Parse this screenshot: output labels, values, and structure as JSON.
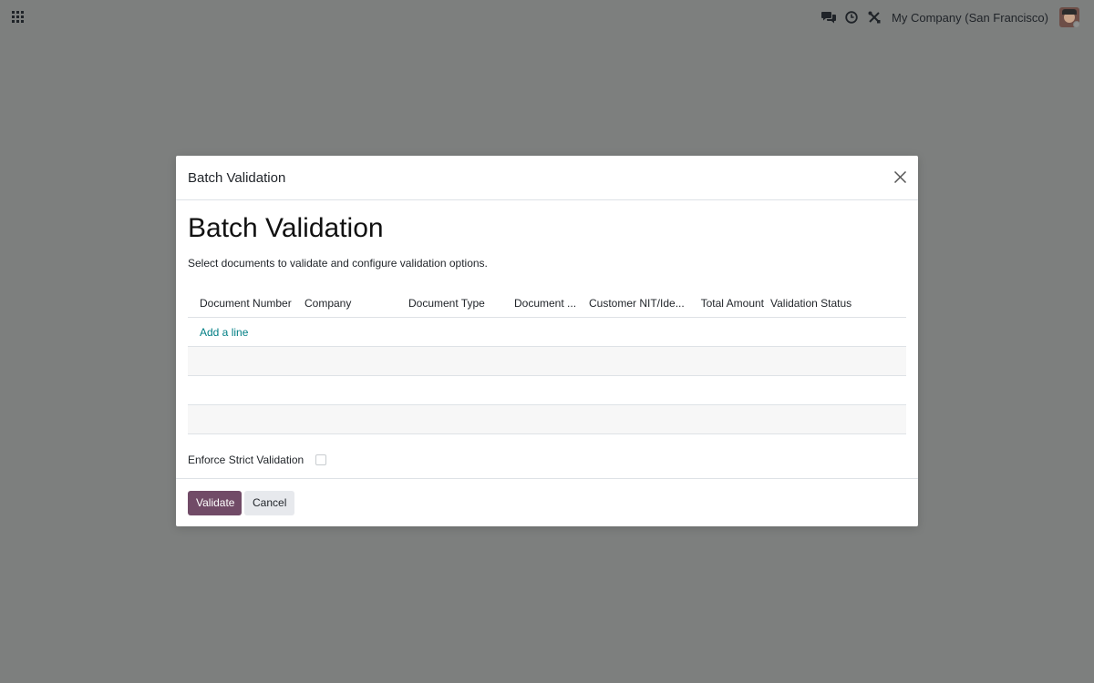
{
  "navbar": {
    "company": "My Company (San Francisco)",
    "icons": [
      "apps-icon",
      "chat-icon",
      "clock-icon",
      "tools-icon"
    ]
  },
  "dialog": {
    "header_title": "Batch Validation",
    "form_title": "Batch Validation",
    "description": "Select documents to validate and configure validation options.",
    "columns": [
      "Document Number",
      "Company",
      "Document Type",
      "Document ...",
      "Customer NIT/Ide...",
      "Total Amount",
      "Validation Status"
    ],
    "add_line": "Add a line",
    "strict_label": "Enforce Strict Validation",
    "strict_checked": false,
    "validate_label": "Validate",
    "cancel_label": "Cancel"
  },
  "colors": {
    "primary": "#714b67",
    "link": "#017e84",
    "backdrop": "#7d7f7e"
  }
}
